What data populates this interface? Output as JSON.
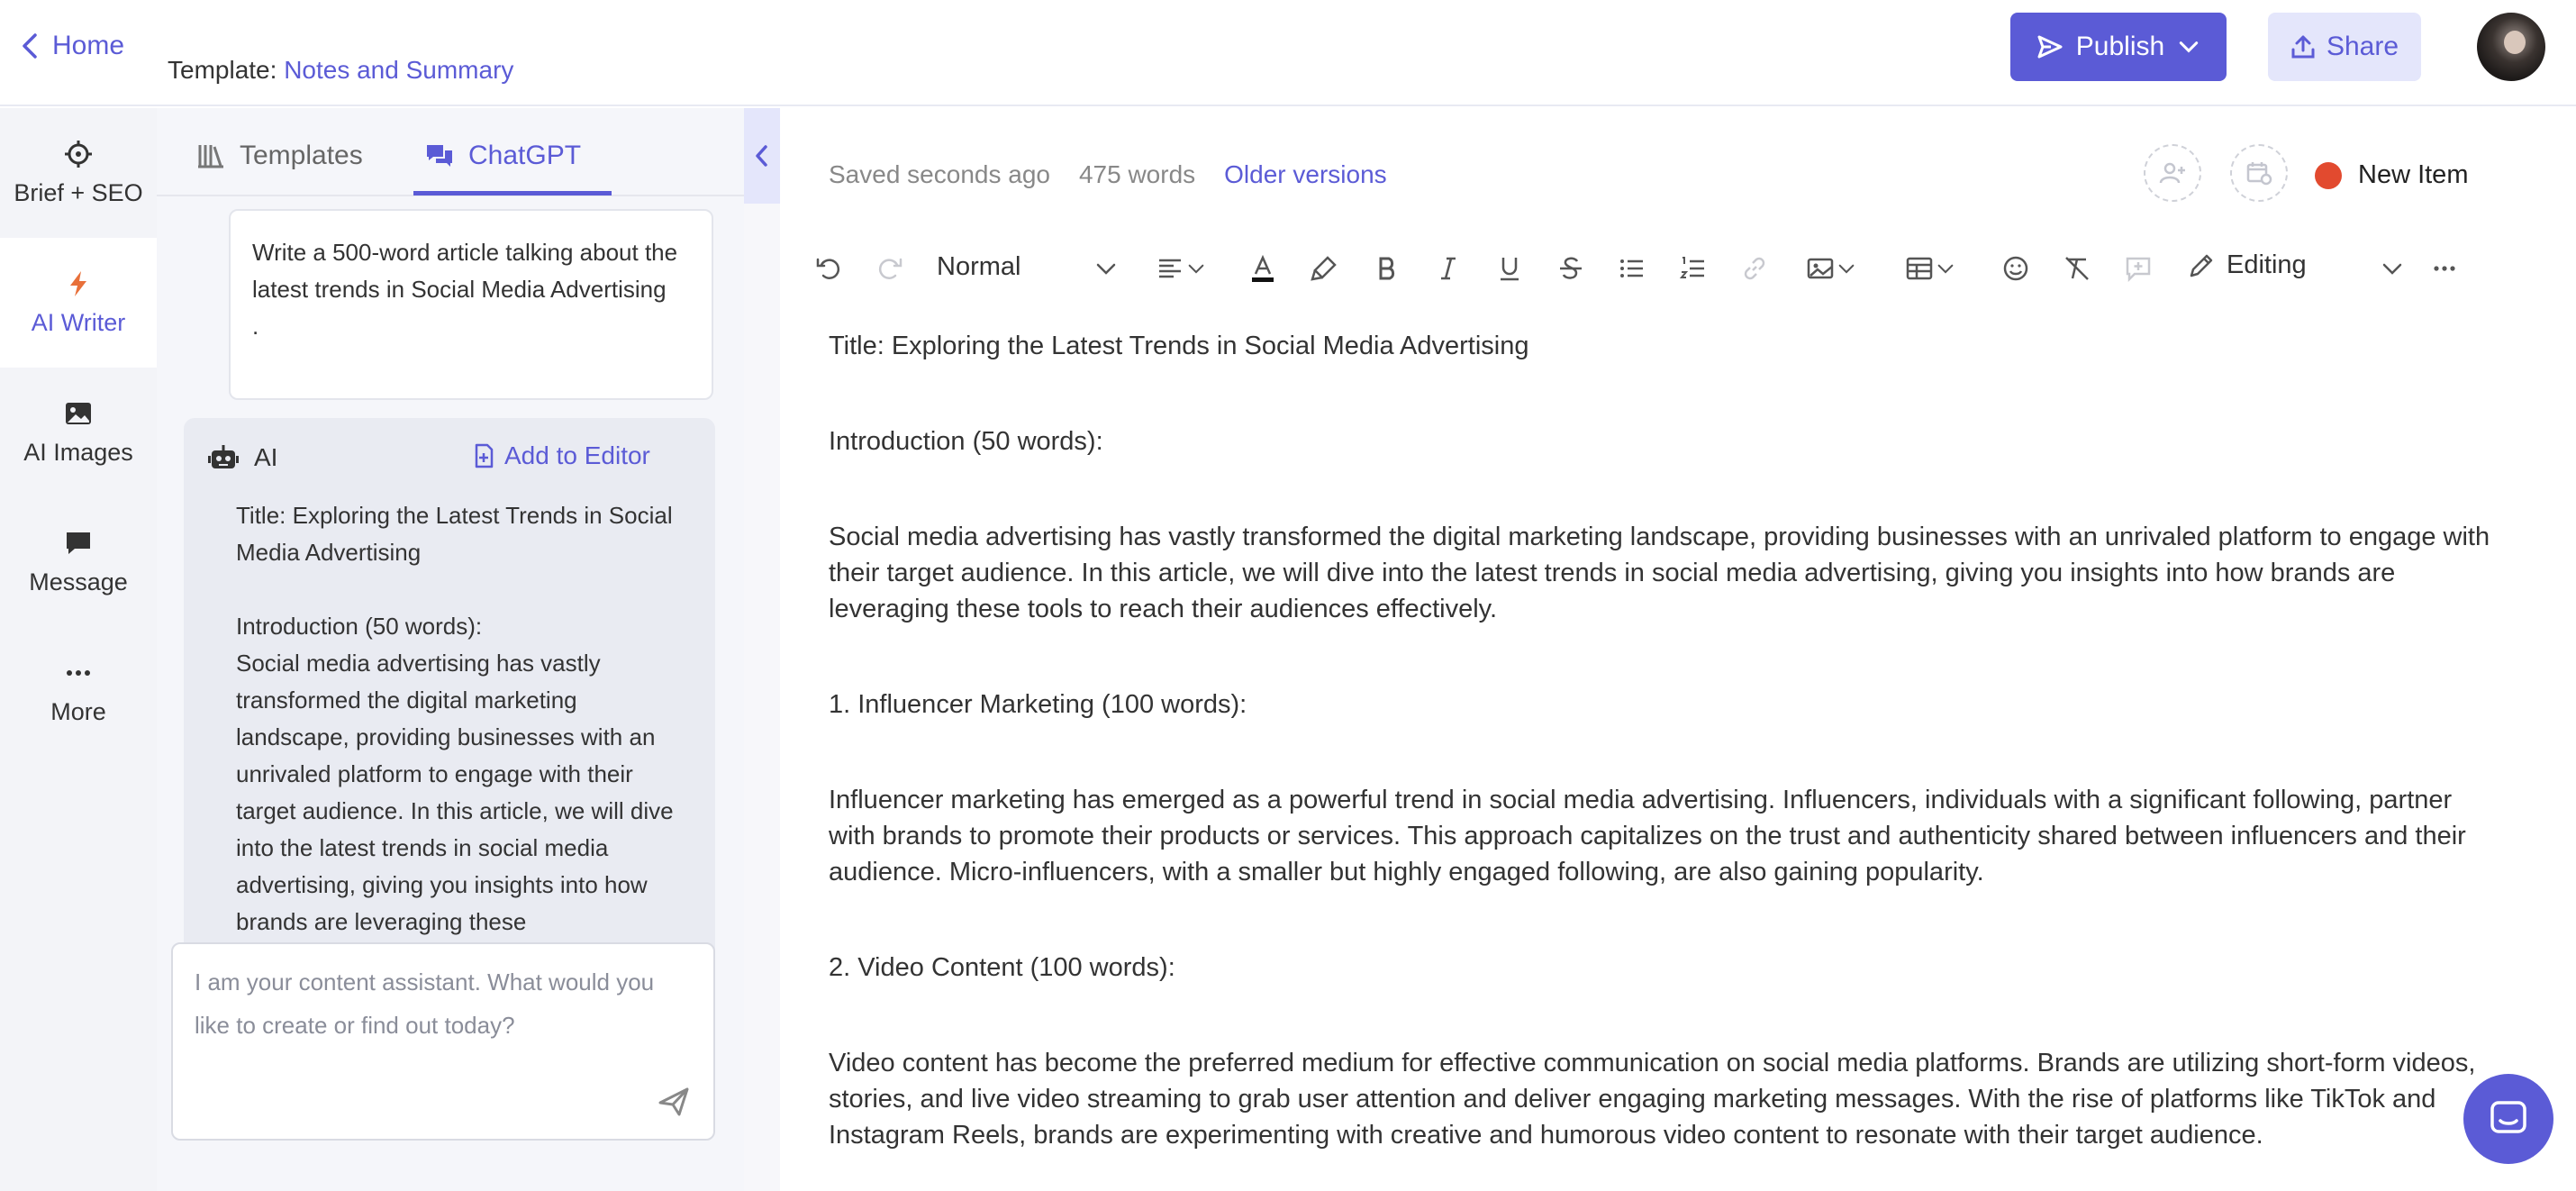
{
  "header": {
    "back_label": "Home",
    "template_prefix": "Template:",
    "template_name": "Notes and Summary",
    "publish_label": "Publish",
    "share_label": "Share"
  },
  "left_nav": {
    "items": [
      {
        "label": "Brief + SEO",
        "icon": "crosshair-icon"
      },
      {
        "label": "AI Writer",
        "icon": "bolt-icon"
      },
      {
        "label": "AI Images",
        "icon": "image-icon"
      },
      {
        "label": "Message",
        "icon": "message-icon"
      },
      {
        "label": "More",
        "icon": "dots-icon"
      }
    ],
    "active": "AI Writer"
  },
  "panel": {
    "tabs": [
      {
        "label": "Templates",
        "icon": "library-icon"
      },
      {
        "label": "ChatGPT",
        "icon": "chat-icon"
      }
    ],
    "active_tab": "ChatGPT",
    "prompt": "Write a 500-word article talking about the latest trends in Social Media Advertising\n.",
    "ai_label": "AI",
    "add_to_editor": "Add to Editor",
    "ai_response": "Title: Exploring the Latest Trends in Social Media Advertising\n\nIntroduction (50 words):\nSocial media advertising has vastly transformed the digital marketing landscape, providing businesses with an unrivaled platform to engage with their target audience. In this article, we will dive into the latest trends in social media advertising, giving you insights into how brands are leveraging these",
    "input_placeholder": "I am your content assistant. What would you like to create or find out today?"
  },
  "editor": {
    "saved_status": "Saved seconds ago",
    "word_count": "475 words",
    "older_versions": "Older versions",
    "new_item_label": "New Item",
    "status_color": "#e24a2f",
    "style_value": "Normal",
    "mode_value": "Editing",
    "paragraphs": [
      "Title: Exploring the Latest Trends in Social Media Advertising",
      "Introduction (50 words):",
      "Social media advertising has vastly transformed the digital marketing landscape, providing businesses with an unrivaled platform to engage with their target audience. In this article, we will dive into the latest trends in social media advertising, giving you insights into how brands are leveraging these tools to reach their audiences effectively.",
      "1. Influencer Marketing (100 words):",
      "Influencer marketing has emerged as a powerful trend in social media advertising. Influencers, individuals with a significant following, partner with brands to promote their products or services. This approach capitalizes on the trust and authenticity shared between influencers and their audience. Micro-influencers, with a smaller but highly engaged following, are also gaining popularity.",
      "2. Video Content (100 words):",
      "Video content has become the preferred medium for effective communication on social media platforms. Brands are utilizing short-form videos, stories, and live video streaming to grab user attention and deliver engaging marketing messages. With the rise of platforms like TikTok and Instagram Reels, brands are experimenting with creative and humorous video content to resonate with their target audience."
    ]
  },
  "colors": {
    "accent": "#5b5bd6",
    "accent_light": "#e4e6fb",
    "sidebar_bg": "#f3f4f8"
  }
}
